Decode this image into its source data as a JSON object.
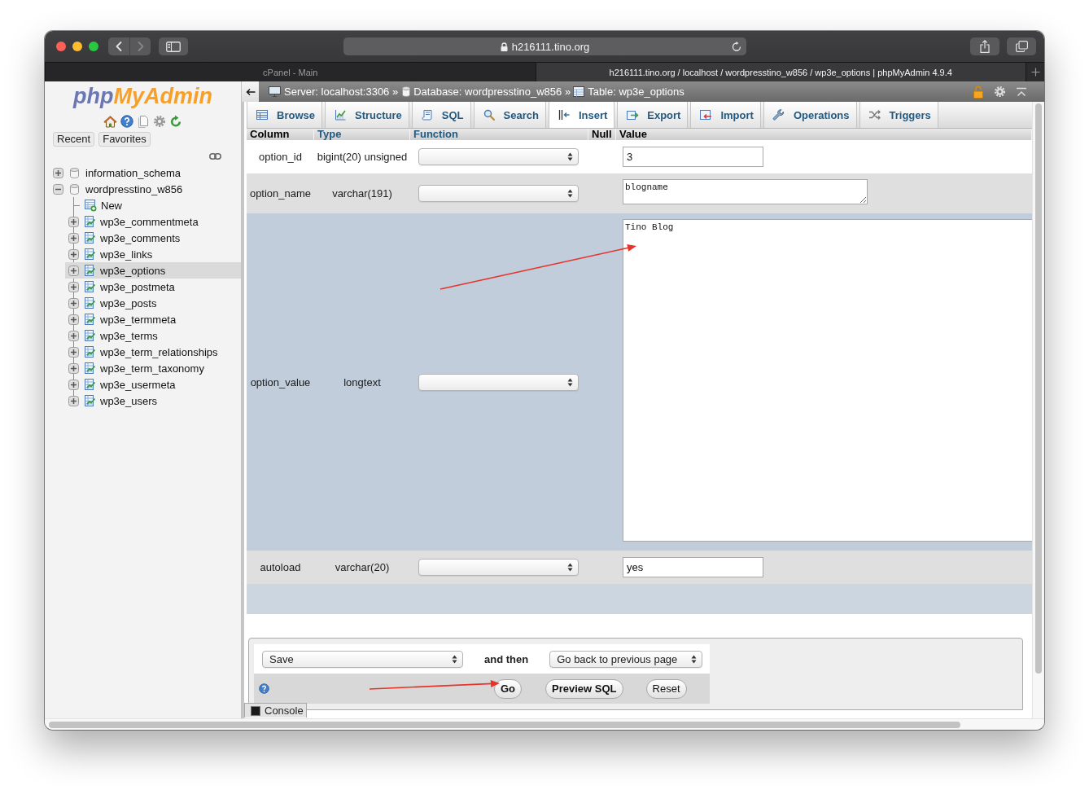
{
  "browser": {
    "back_disabled": false,
    "forward_disabled": true,
    "url": "h216111.tino.org",
    "tabs": [
      {
        "title": "cPanel - Main",
        "selected": false
      },
      {
        "title": "h216111.tino.org / localhost / wordpresstino_w856 / wp3e_options | phpMyAdmin 4.9.4",
        "selected": true
      }
    ]
  },
  "sidebar": {
    "logo": {
      "first": "php",
      "second": "MyAdmin"
    },
    "buttons": [
      "Recent",
      "Favorites"
    ],
    "tree": [
      {
        "label": "information_schema",
        "kind": "database",
        "expanded": false,
        "selected": false
      },
      {
        "label": "wordpresstino_w856",
        "kind": "database",
        "expanded": true,
        "selected": false,
        "children": [
          {
            "label": "New",
            "kind": "new",
            "selected": false
          },
          {
            "label": "wp3e_commentmeta",
            "kind": "table",
            "expanded": false,
            "selected": false
          },
          {
            "label": "wp3e_comments",
            "kind": "table",
            "expanded": false,
            "selected": false
          },
          {
            "label": "wp3e_links",
            "kind": "table",
            "expanded": false,
            "selected": false
          },
          {
            "label": "wp3e_options",
            "kind": "table",
            "expanded": false,
            "selected": true
          },
          {
            "label": "wp3e_postmeta",
            "kind": "table",
            "expanded": false,
            "selected": false
          },
          {
            "label": "wp3e_posts",
            "kind": "table",
            "expanded": false,
            "selected": false
          },
          {
            "label": "wp3e_termmeta",
            "kind": "table",
            "expanded": false,
            "selected": false
          },
          {
            "label": "wp3e_terms",
            "kind": "table",
            "expanded": false,
            "selected": false
          },
          {
            "label": "wp3e_term_relationships",
            "kind": "table",
            "expanded": false,
            "selected": false
          },
          {
            "label": "wp3e_term_taxonomy",
            "kind": "table",
            "expanded": false,
            "selected": false
          },
          {
            "label": "wp3e_usermeta",
            "kind": "table",
            "expanded": false,
            "selected": false
          },
          {
            "label": "wp3e_users",
            "kind": "table",
            "expanded": false,
            "selected": false
          }
        ]
      }
    ]
  },
  "breadcrumb": [
    {
      "kind": "server",
      "text": "Server: localhost:3306 »"
    },
    {
      "kind": "database",
      "text": "Database: wordpresstino_w856 »"
    },
    {
      "kind": "table",
      "text": "Table: wp3e_options"
    }
  ],
  "tabs": [
    {
      "label": "Browse",
      "kind": "browse",
      "selected": false
    },
    {
      "label": "Structure",
      "kind": "structure",
      "selected": false
    },
    {
      "label": "SQL",
      "kind": "sql",
      "selected": false
    },
    {
      "label": "Search",
      "kind": "search",
      "selected": false
    },
    {
      "label": "Insert",
      "kind": "insert",
      "selected": true
    },
    {
      "label": "Export",
      "kind": "export",
      "selected": false
    },
    {
      "label": "Import",
      "kind": "import",
      "selected": false
    },
    {
      "label": "Operations",
      "kind": "operations",
      "selected": false
    },
    {
      "label": "Triggers",
      "kind": "triggers",
      "selected": false
    }
  ],
  "table": {
    "columns": [
      {
        "label": "Column",
        "link": false
      },
      {
        "label": "Type",
        "link": true
      },
      {
        "label": "Function",
        "link": true
      },
      {
        "label": "Null",
        "link": false
      },
      {
        "label": "Value",
        "link": false
      }
    ],
    "rows": [
      {
        "column": "option_id",
        "type": "bigint(20) unsigned",
        "kind": "input",
        "value": "3",
        "marked": false
      },
      {
        "column": "option_name",
        "type": "varchar(191)",
        "kind": "textarea",
        "value": "blogname",
        "marked": false
      },
      {
        "column": "option_value",
        "type": "longtext",
        "kind": "editor",
        "value": "Tino Blog",
        "marked": true
      },
      {
        "column": "autoload",
        "type": "varchar(20)",
        "kind": "input",
        "value": "yes",
        "marked": false
      }
    ]
  },
  "actions": {
    "action": "Save",
    "joiner": "and then",
    "after": "Go back to previous page",
    "buttons": [
      {
        "label": "Go",
        "kind": "go"
      },
      {
        "label": "Preview SQL",
        "kind": "preview"
      },
      {
        "label": "Reset",
        "kind": "reset"
      }
    ]
  },
  "console": {
    "label": "Console"
  }
}
